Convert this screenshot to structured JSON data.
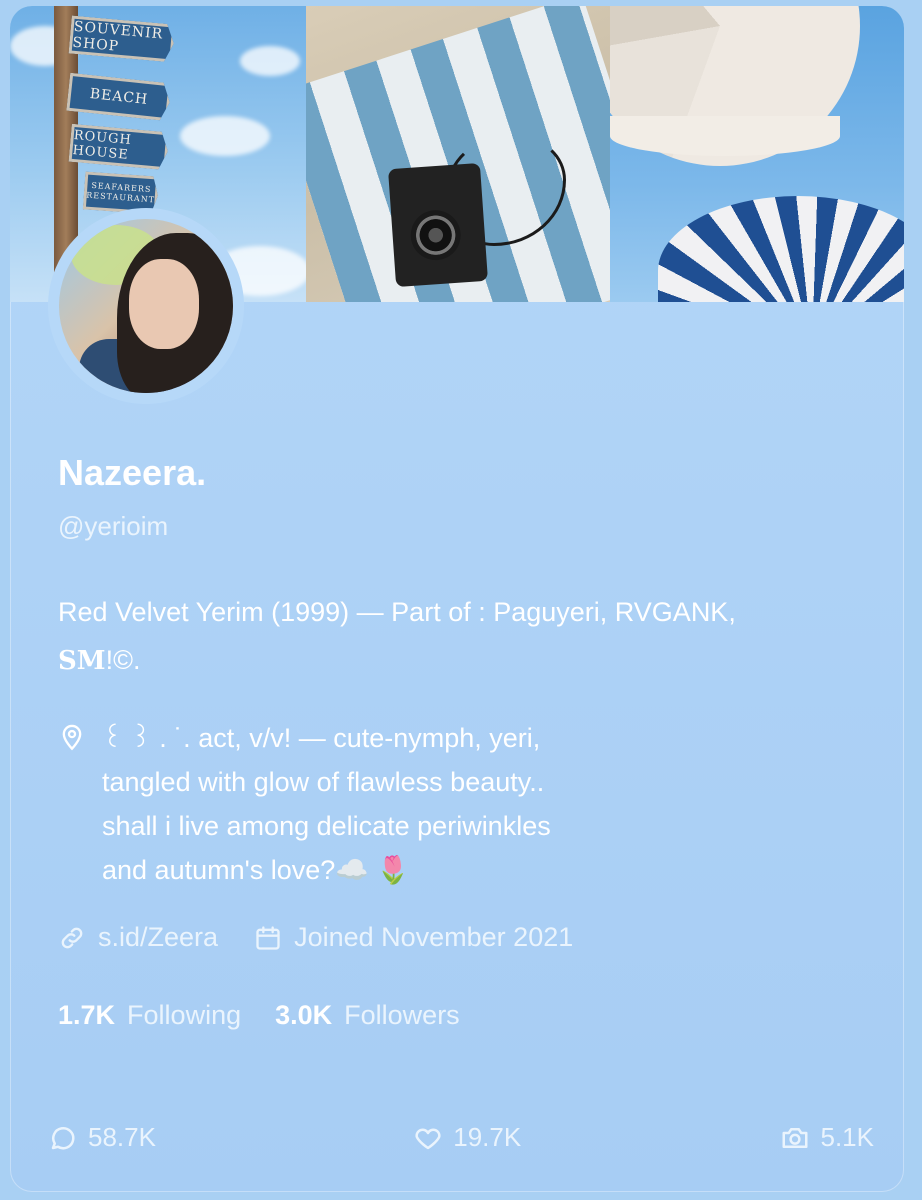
{
  "profile": {
    "name": "Nazeera.",
    "handle": "@yerioim",
    "bio_line1": "Red Velvet Yerim (1999) — Part of : Paguyeri, RVGANK,",
    "bio_line2_sm": "SM",
    "bio_line2_rest": "!©.",
    "location_lines": [
      "꒰ ꒱ . ˙. act, v/v! — cute-nymph, yeri,",
      "tangled with glow of flawless beauty..",
      "shall i live among delicate periwinkles",
      "and autumn's love?☁️ 🌷"
    ],
    "link": "s.id/Zeera",
    "joined": "Joined November 2021",
    "following_count": "1.7K",
    "following_label": "Following",
    "followers_count": "3.0K",
    "followers_label": "Followers"
  },
  "header_photos": {
    "signs": [
      "SOUVENIR SHOP",
      "BEACH",
      "ROUGH HOUSE",
      "SEAFARERS RESTAURANT"
    ]
  },
  "footer": {
    "comments": "58.7K",
    "likes": "19.7K",
    "media": "5.1K"
  },
  "icons": {
    "location": "location-pin-icon",
    "link": "link-icon",
    "calendar": "calendar-icon",
    "comment": "comment-icon",
    "heart": "heart-icon",
    "camera": "camera-icon"
  },
  "colors": {
    "background": "#a9d0f3",
    "card": "#b4d7f8",
    "text": "#ffffff",
    "muted_text": "#eaf4fd"
  }
}
